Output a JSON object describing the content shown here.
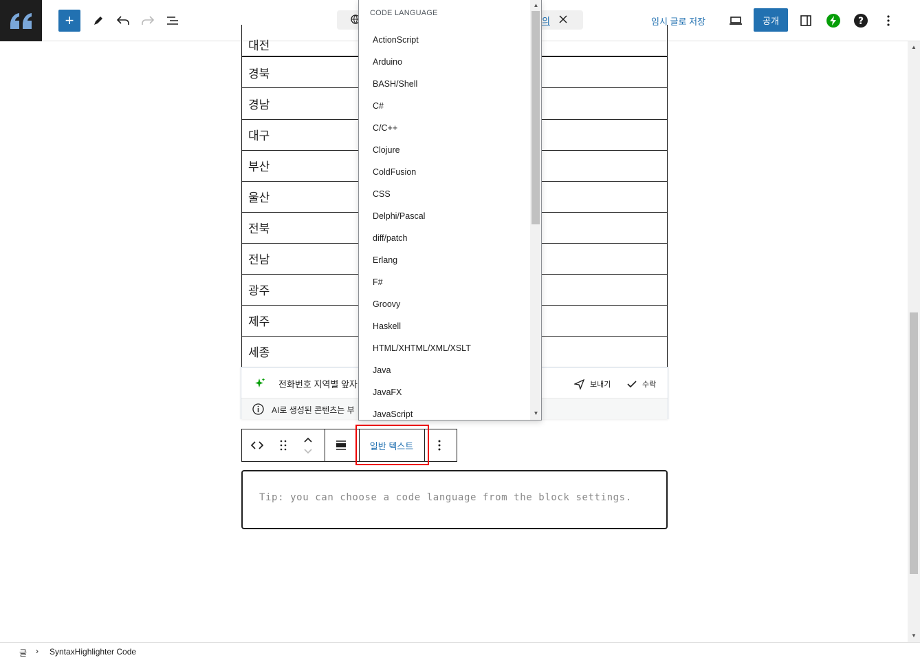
{
  "toolbar": {
    "cmd_link": "의",
    "save_draft": "임시 글로 저장",
    "publish": "공개"
  },
  "table_rows": [
    "대전",
    "경북",
    "경남",
    "대구",
    "부산",
    "울산",
    "전북",
    "전남",
    "광주",
    "제주",
    "세종"
  ],
  "ai_panel": {
    "prompt": "전화번호 지역별 앞자",
    "notice": "AI로 생성된 콘텐츠는 부",
    "send_label": "보내기",
    "accept_label": "수락"
  },
  "block_toolbar": {
    "language_button": "일반 텍스트"
  },
  "code_block": {
    "placeholder": "Tip: you can choose a code language from the block settings."
  },
  "dropdown": {
    "title": "CODE LANGUAGE",
    "items": [
      "ActionScript",
      "Arduino",
      "BASH/Shell",
      "C#",
      "C/C++",
      "Clojure",
      "ColdFusion",
      "CSS",
      "Delphi/Pascal",
      "diff/patch",
      "Erlang",
      "F#",
      "Groovy",
      "Haskell",
      "HTML/XHTML/XML/XSLT",
      "Java",
      "JavaFX",
      "JavaScript"
    ]
  },
  "footer": {
    "crumb_root": "글",
    "crumb_block": "SyntaxHighlighter Code"
  },
  "colors": {
    "accent": "#2271b1",
    "dark": "#1e1e1e",
    "highlight": "#e00000",
    "jetpack": "#069e08"
  }
}
